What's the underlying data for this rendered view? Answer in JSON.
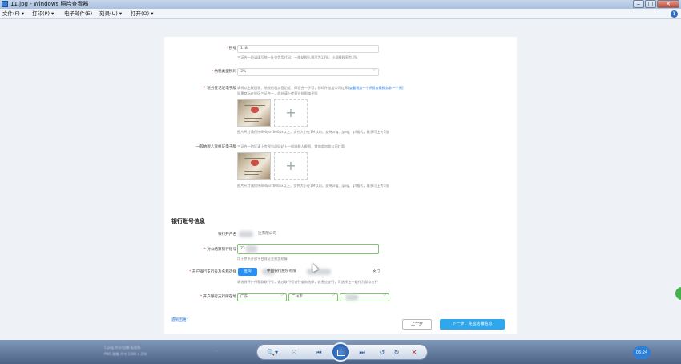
{
  "window": {
    "title": "11.jpg - Windows 照片查看器",
    "minimize": "‒",
    "maximize": "□",
    "close": "✕"
  },
  "menu": {
    "items": [
      "文件(F) ▾",
      "打印(P) ▾",
      "电子邮件(E)",
      "刻录(U) ▾",
      "打开(O) ▾"
    ],
    "help": "?"
  },
  "form": {
    "tax_no": {
      "label": "税号",
      "value": "1                    .8",
      "hint": "三证合一的请填写统一社会信用代码；一般纳税人税率为13%；小规模税率为3%"
    },
    "tax_rate": {
      "label": "纳税类型税码",
      "value": "3%"
    },
    "tax_reg_cert": {
      "label": "税务登记证电子版",
      "hint1": "请将以上税国税、地税的税务登记证、四证合一于可，那印件加盖公司红章",
      "link1": "[查看税务一个例]",
      "link2": "[查看税务非一个例]",
      "hint2": "如果商标在地区三证合一，此处请上传营业执照电子版",
      "note": "图片尺寸请保持800px*800px以上，文件大小在1M以内，支持png、jpeg、gif格式，最多可上传1张"
    },
    "general_taxpayer_cert": {
      "label": "一般纳税人资格证电子版",
      "hint": "三证合一地区请上传税务局网站上一般纳税人截图，需加盖加盖公司红章",
      "note": "图片尺寸请保持800px*800px以上，文件大小在1M以内，支持png、jpeg、gif格式，最多可上传1张"
    }
  },
  "bank": {
    "section_title": "银行账号信息",
    "account_name": {
      "label": "银行开户名",
      "value": "注有限公司"
    },
    "account_no": {
      "label": "对公结算银行账号",
      "value": "72",
      "hint": "用于京东开放平台保证金账务结算"
    },
    "branch": {
      "label": "开户银行支行号及名称选择",
      "query": "查询",
      "value": "中国银行股份有限",
      "suffix": "支行",
      "hint": "请选择开户行获取联行号，通过联行号进行查询选择，若无应支行，可选择上一级作为保存支行"
    },
    "location": {
      "label": "开户银行支行所在地",
      "province": "广东",
      "city": "广州市",
      "district": ""
    }
  },
  "footer": {
    "help_link": "遇到困难？",
    "prev": "上一步",
    "next": "下一步，完善店铺信息"
  },
  "viewer_bar": {
    "info1": "1.png    大小/日期 标签等",
    "info2": "PNG 图像    尺寸 1386 x 256",
    "info3": "...",
    "zoom": "🔍▾",
    "fit": "⤧",
    "prev": "⏮",
    "next": "⏭",
    "rotate_ccw": "↺",
    "rotate_cw": "↻",
    "delete": "✕",
    "clock": "06:24"
  }
}
